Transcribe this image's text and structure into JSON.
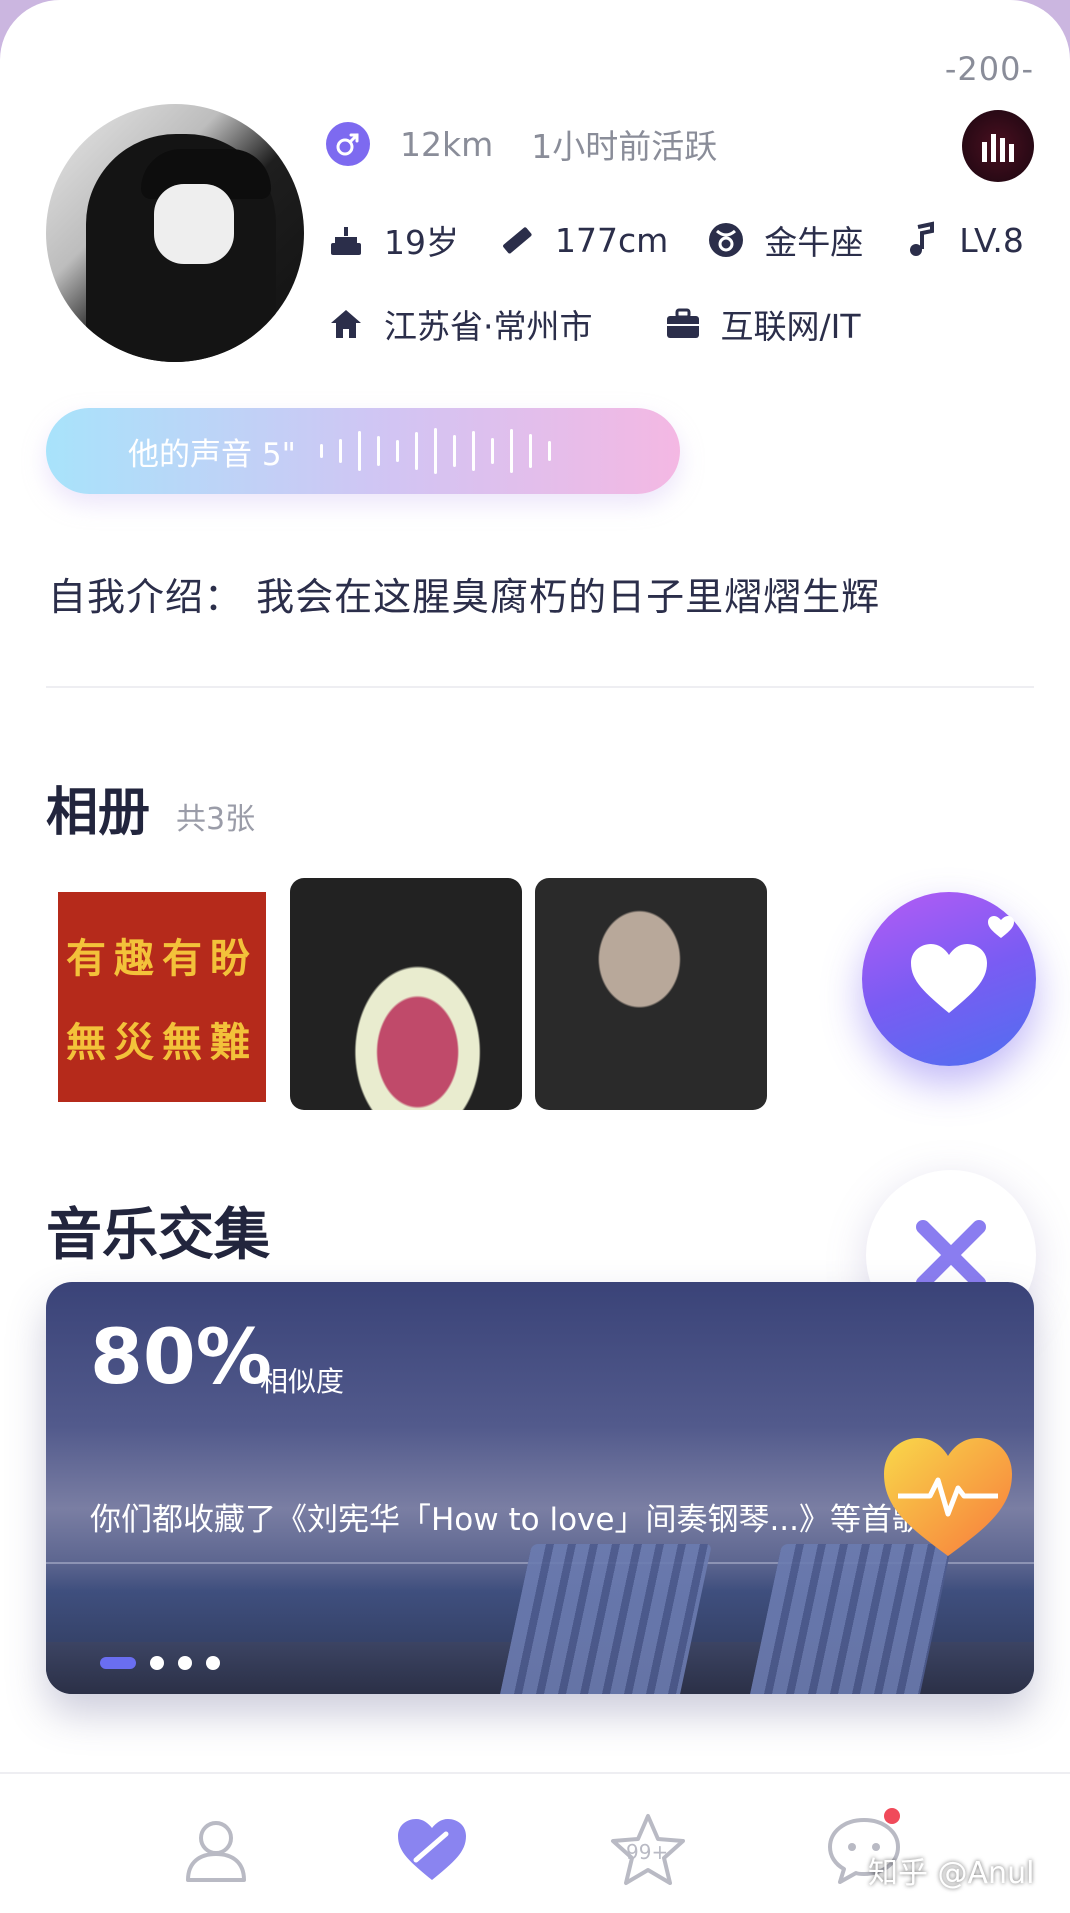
{
  "header": {
    "rank": "-200-",
    "distance": "12km",
    "active": "1小时前活跃",
    "age": "19岁",
    "height": "177cm",
    "zodiac": "金牛座",
    "level": "LV.8",
    "location": "江苏省·常州市",
    "industry": "互联网/IT"
  },
  "voice": {
    "label": "他的声音 5\""
  },
  "intro": {
    "text": "自我介绍：  我会在这腥臭腐朽的日子里熠熠生辉"
  },
  "album": {
    "title": "相册",
    "count": "共3张",
    "photo1_lines": [
      "有趣有盼",
      "無災無難"
    ]
  },
  "music": {
    "title": "音乐交集",
    "percent": "80%",
    "percent_label": "相似度",
    "common_text": "你们都收藏了《刘宪华「How to love」间奏钢琴...》等首歌"
  },
  "tabs": {
    "star_badge": "99+"
  },
  "watermark": "知乎 @Anul",
  "colors": {
    "accent": "#7d6af0",
    "like_gradient_start": "#b45cf5",
    "like_gradient_end": "#4f6ff0",
    "close_x": "#8a7df0",
    "notification": "#f04a5a"
  }
}
